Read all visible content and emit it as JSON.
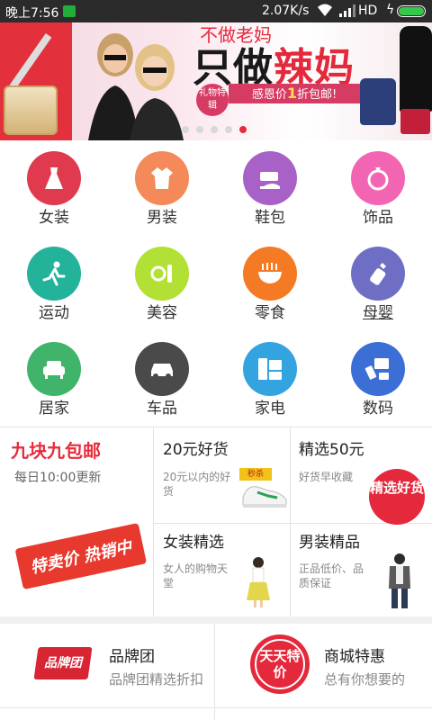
{
  "status_bar": {
    "time": "晚上7:56",
    "net_speed": "2.07K/s",
    "hd": "HD",
    "battery_level": 1.0
  },
  "banner": {
    "headline_top": "不做老妈",
    "headline_main_1": "只做",
    "headline_main_2": "辣妈",
    "gift_tag": "礼物特辑",
    "promo_prefix": "感恩价",
    "promo_number": "1",
    "promo_suffix": "折包邮!",
    "slide_count": 5,
    "active_slide": 5
  },
  "categories": [
    {
      "label": "女装",
      "icon": "dress-icon",
      "color": "#e03a4f"
    },
    {
      "label": "男装",
      "icon": "shirt-icon",
      "color": "#f4895a"
    },
    {
      "label": "鞋包",
      "icon": "shoe-bag-icon",
      "color": "#a761c7"
    },
    {
      "label": "饰品",
      "icon": "accessory-icon",
      "color": "#f265b3"
    },
    {
      "label": "运动",
      "icon": "runner-icon",
      "color": "#23b39a"
    },
    {
      "label": "美容",
      "icon": "cosmetics-icon",
      "color": "#b3e035"
    },
    {
      "label": "零食",
      "icon": "snack-bowl-icon",
      "color": "#f47b23"
    },
    {
      "label": "母婴",
      "icon": "baby-bottle-icon",
      "color": "#6e6fc4"
    },
    {
      "label": "居家",
      "icon": "sofa-icon",
      "color": "#3fb46a"
    },
    {
      "label": "车品",
      "icon": "car-icon",
      "color": "#4a4a4a"
    },
    {
      "label": "家电",
      "icon": "appliance-icon",
      "color": "#33a4e0"
    },
    {
      "label": "数码",
      "icon": "digital-icon",
      "color": "#3b6fd6"
    }
  ],
  "promo": {
    "main_title": "九块九包邮",
    "main_sub": "每日10:00更新",
    "main_badge": "特卖价 热销中",
    "tiles": [
      {
        "title": "20元好货",
        "sub": "20元以内的好货",
        "tag": "秒杀"
      },
      {
        "title": "精选50元",
        "sub": "好货早收藏",
        "seal": "精选好货"
      },
      {
        "title": "女装精选",
        "sub": "女人的购物天堂"
      },
      {
        "title": "男装精品",
        "sub": "正品低价、品质保证"
      }
    ]
  },
  "bottom": {
    "brand_title": "品牌团",
    "brand_sub": "品牌团精选折扣",
    "brand_logo_text": "品牌团",
    "mall_title": "商城特惠",
    "mall_sub": "总有你想要的",
    "mall_seal_text": "天天特价"
  },
  "colors": {
    "accent": "#e62c3c",
    "status_bar": "#2b2b2b"
  }
}
